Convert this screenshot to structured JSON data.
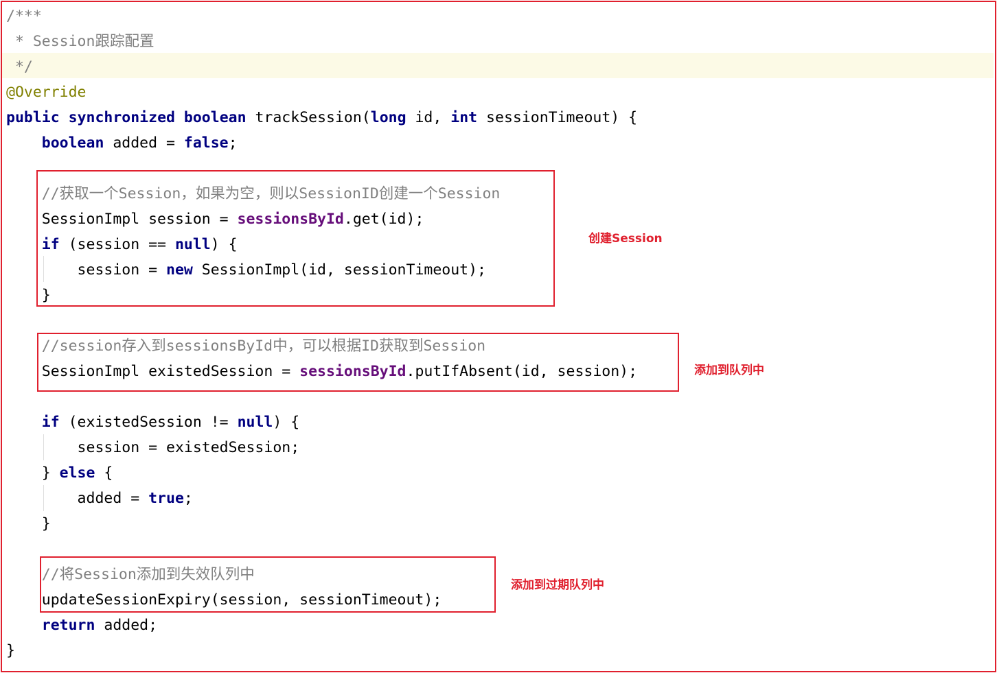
{
  "code": {
    "lines": [
      [
        {
          "t": "/***",
          "c": "comment"
        }
      ],
      [
        {
          "t": " * Session跟踪配置",
          "c": "comment"
        }
      ],
      [
        {
          "t": " */",
          "c": "comment"
        }
      ],
      [
        {
          "t": "@Override",
          "c": "annotation"
        }
      ],
      [
        {
          "t": "public",
          "c": "kw"
        },
        {
          "t": " ",
          "c": "plain"
        },
        {
          "t": "synchronized",
          "c": "kw"
        },
        {
          "t": " ",
          "c": "plain"
        },
        {
          "t": "boolean",
          "c": "kw"
        },
        {
          "t": " trackSession(",
          "c": "plain"
        },
        {
          "t": "long",
          "c": "kw"
        },
        {
          "t": " id, ",
          "c": "plain"
        },
        {
          "t": "int",
          "c": "kw"
        },
        {
          "t": " sessionTimeout) {",
          "c": "plain"
        }
      ],
      [
        {
          "t": "    ",
          "c": "plain"
        },
        {
          "t": "boolean",
          "c": "kw"
        },
        {
          "t": " added = ",
          "c": "plain"
        },
        {
          "t": "false",
          "c": "kw"
        },
        {
          "t": ";",
          "c": "plain"
        }
      ],
      [
        {
          "t": "",
          "c": "plain"
        }
      ],
      [
        {
          "t": "    //获取一个Session，如果为空，则以SessionID创建一个Session",
          "c": "comment"
        }
      ],
      [
        {
          "t": "    SessionImpl session = ",
          "c": "plain"
        },
        {
          "t": "sessionsById",
          "c": "field"
        },
        {
          "t": ".get(id);",
          "c": "plain"
        }
      ],
      [
        {
          "t": "    ",
          "c": "plain"
        },
        {
          "t": "if",
          "c": "kw"
        },
        {
          "t": " (session == ",
          "c": "plain"
        },
        {
          "t": "null",
          "c": "kw"
        },
        {
          "t": ") {",
          "c": "plain"
        }
      ],
      [
        {
          "t": "        session = ",
          "c": "plain"
        },
        {
          "t": "new",
          "c": "kw"
        },
        {
          "t": " SessionImpl(id, sessionTimeout);",
          "c": "plain"
        }
      ],
      [
        {
          "t": "    }",
          "c": "plain"
        }
      ],
      [
        {
          "t": "",
          "c": "plain"
        }
      ],
      [
        {
          "t": "    //session存入到sessionsById中，可以根据ID获取到Session",
          "c": "comment"
        }
      ],
      [
        {
          "t": "    SessionImpl existedSession = ",
          "c": "plain"
        },
        {
          "t": "sessionsById",
          "c": "field"
        },
        {
          "t": ".putIfAbsent(id, session);",
          "c": "plain"
        }
      ],
      [
        {
          "t": "",
          "c": "plain"
        }
      ],
      [
        {
          "t": "    ",
          "c": "plain"
        },
        {
          "t": "if",
          "c": "kw"
        },
        {
          "t": " (existedSession != ",
          "c": "plain"
        },
        {
          "t": "null",
          "c": "kw"
        },
        {
          "t": ") {",
          "c": "plain"
        }
      ],
      [
        {
          "t": "        session = existedSession;",
          "c": "plain"
        }
      ],
      [
        {
          "t": "    } ",
          "c": "plain"
        },
        {
          "t": "else",
          "c": "kw"
        },
        {
          "t": " {",
          "c": "plain"
        }
      ],
      [
        {
          "t": "        added = ",
          "c": "plain"
        },
        {
          "t": "true",
          "c": "kw"
        },
        {
          "t": ";",
          "c": "plain"
        }
      ],
      [
        {
          "t": "    }",
          "c": "plain"
        }
      ],
      [
        {
          "t": "",
          "c": "plain"
        }
      ],
      [
        {
          "t": "    //将Session添加到失效队列中",
          "c": "comment"
        }
      ],
      [
        {
          "t": "    updateSessionExpiry(session, sessionTimeout);",
          "c": "plain"
        }
      ],
      [
        {
          "t": "    ",
          "c": "plain"
        },
        {
          "t": "return",
          "c": "kw"
        },
        {
          "t": " added;",
          "c": "plain"
        }
      ],
      [
        {
          "t": "}",
          "c": "plain"
        }
      ]
    ]
  },
  "annotations": {
    "create_session": "创建Session",
    "add_to_queue": "添加到队列中",
    "add_to_expiry_queue": "添加到过期队列中"
  },
  "colors": {
    "keyword": "#000080",
    "comment": "#808080",
    "annotation": "#808000",
    "field": "#660e7a",
    "highlight_box": "#e0202e",
    "caret_row": "#fcfae6"
  }
}
